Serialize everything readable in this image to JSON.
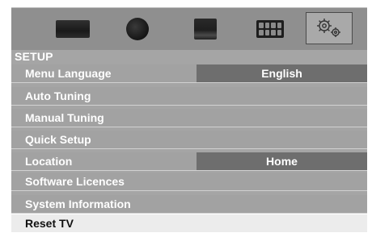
{
  "menu_title": "SETUP",
  "tabs": [
    {
      "icon": "tv-picture-icon"
    },
    {
      "icon": "sound-globe-icon"
    },
    {
      "icon": "media-icon"
    },
    {
      "icon": "grid-icon"
    },
    {
      "icon": "gears-icon",
      "selected": true
    }
  ],
  "items": [
    {
      "label": "Menu Language",
      "value": "English"
    },
    {
      "label": "Auto Tuning"
    },
    {
      "label": "Manual Tuning"
    },
    {
      "label": "Quick Setup"
    },
    {
      "label": "Location",
      "value": "Home"
    },
    {
      "label": "Software Licences"
    },
    {
      "label": "System Information"
    },
    {
      "label": "Reset TV",
      "selected": true
    }
  ]
}
